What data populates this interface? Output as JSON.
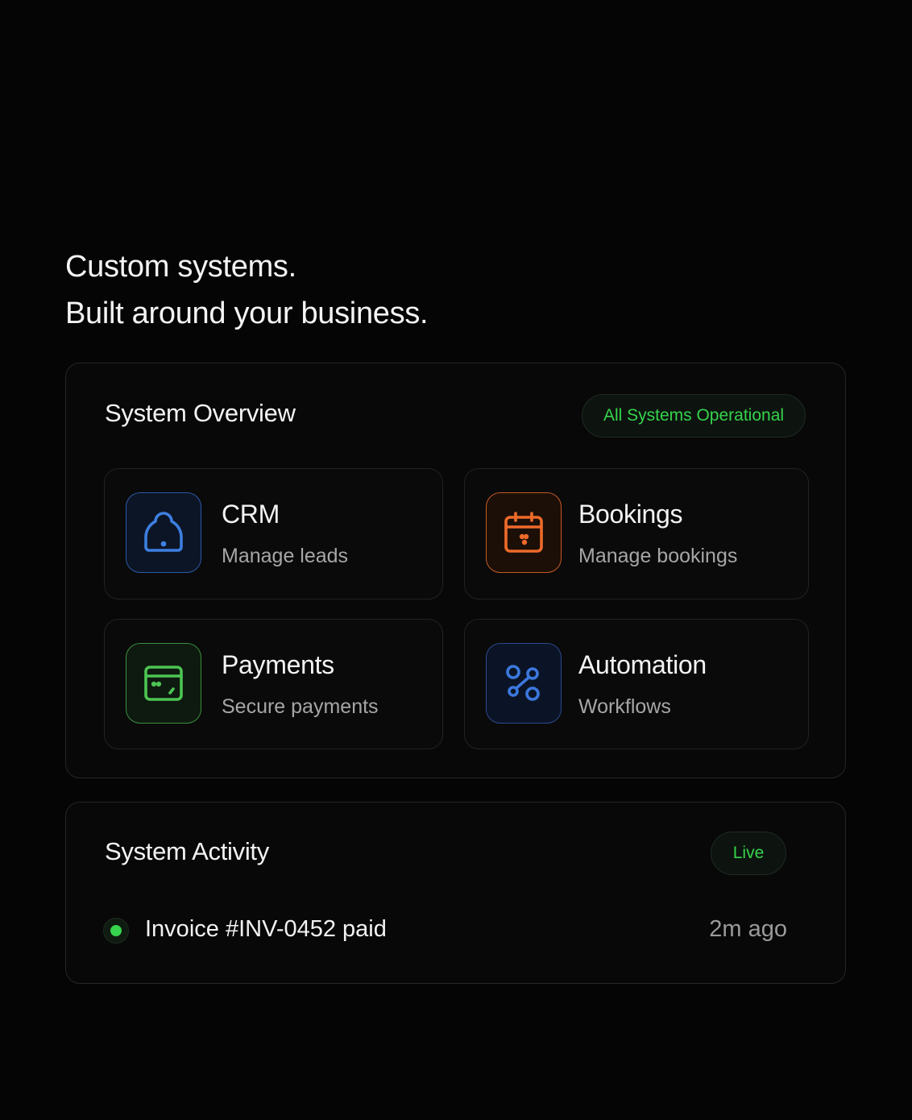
{
  "hero": {
    "line1": "Custom systems.",
    "line2": "Built around your business."
  },
  "overview": {
    "title": "System Overview",
    "status": "All Systems Operational",
    "cards": [
      {
        "title": "CRM",
        "subtitle": "Manage leads",
        "icon": "home-icon",
        "color": "#3d7fe0"
      },
      {
        "title": "Bookings",
        "subtitle": "Manage bookings",
        "icon": "calendar-icon",
        "color": "#ee6a2a"
      },
      {
        "title": "Payments",
        "subtitle": "Secure payments",
        "icon": "wallet-icon",
        "color": "#4cc552"
      },
      {
        "title": "Automation",
        "subtitle": "Workflows",
        "icon": "workflow-icon",
        "color": "#3b78de"
      }
    ]
  },
  "activity": {
    "title": "System Activity",
    "badge": "Live",
    "items": [
      {
        "text": "Invoice #INV-0452 paid",
        "time": "2m ago",
        "status_color": "#36d34c"
      }
    ]
  }
}
